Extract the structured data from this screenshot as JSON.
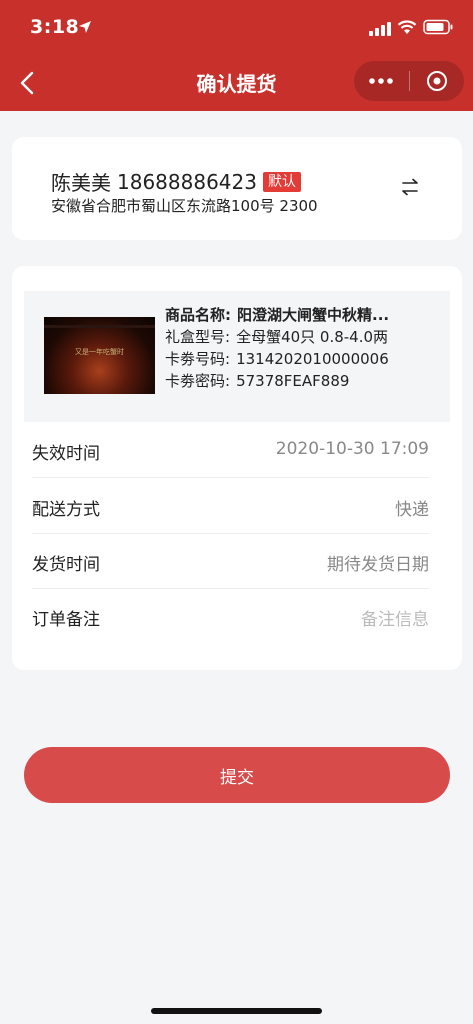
{
  "status_bar": {
    "time": "3:18"
  },
  "nav": {
    "title": "确认提货"
  },
  "address": {
    "name": "陈美美",
    "phone": "18688886423",
    "badge": "默认",
    "detail": "安徽省合肥市蜀山区东流路100号 2300"
  },
  "product": {
    "name_label": "商品名称:",
    "name_value": "阳澄湖大闸蟹中秋精...",
    "box_label": "礼盒型号:",
    "box_value": "全母蟹40只 0.8-4.0两",
    "card_no_label": "卡劵号码:",
    "card_no_value": "1314202010000006",
    "card_pwd_label": "卡劵密码:",
    "card_pwd_value": "57378FEAF889",
    "image_text": "又是一年吃蟹时"
  },
  "fields": {
    "expire_label": "失效时间",
    "expire_value": "2020-10-30 17:09",
    "delivery_label": "配送方式",
    "delivery_value": "快递",
    "ship_label": "发货时间",
    "ship_value": "期待发货日期",
    "note_label": "订单备注",
    "note_placeholder": "备注信息"
  },
  "submit": {
    "label": "提交"
  },
  "colors": {
    "brand": "#c8302c",
    "button": "#d84b4b",
    "badge": "#e33c36"
  }
}
